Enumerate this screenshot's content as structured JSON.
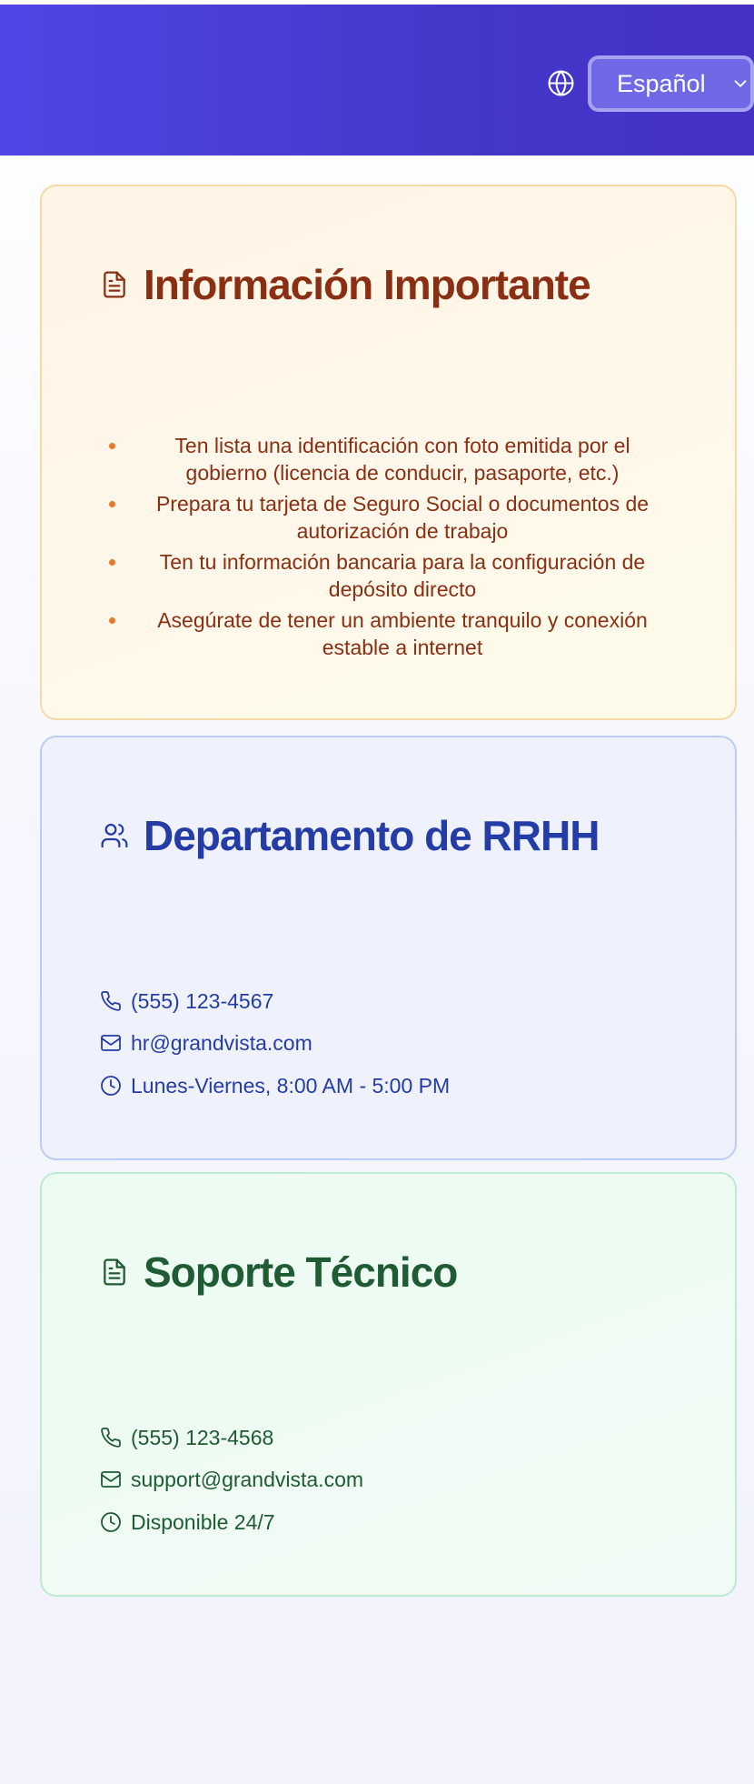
{
  "header": {
    "globe_icon": "globe-icon",
    "language_selected": "Español",
    "language_chevron_icon": "chevron-down-icon"
  },
  "important_info": {
    "icon": "document-icon",
    "title": "Información Importante",
    "items": [
      "Ten lista una identificación con foto emitida por el gobierno (licencia de conducir, pasaporte, etc.)",
      "Prepara tu tarjeta de Seguro Social o documentos de autorización de trabajo",
      "Ten tu información bancaria para la configuración de depósito directo",
      "Asegúrate de tener un ambiente tranquilo y conexión estable a internet"
    ]
  },
  "hr": {
    "icon": "users-icon",
    "title": "Departamento de RRHH",
    "phone": "(555) 123-4567",
    "email": "hr@grandvista.com",
    "hours": "Lunes-Viernes, 8:00 AM - 5:00 PM"
  },
  "support": {
    "icon": "document-icon",
    "title": "Soporte Técnico",
    "phone": "(555) 123-4568",
    "email": "support@grandvista.com",
    "hours": "Disponible 24/7"
  },
  "colors": {
    "header_bg": "#4338ca",
    "info_text": "#8a2f14",
    "info_bullet": "#e97a2c",
    "hr_text": "#243da6",
    "support_text": "#1f5b33"
  }
}
